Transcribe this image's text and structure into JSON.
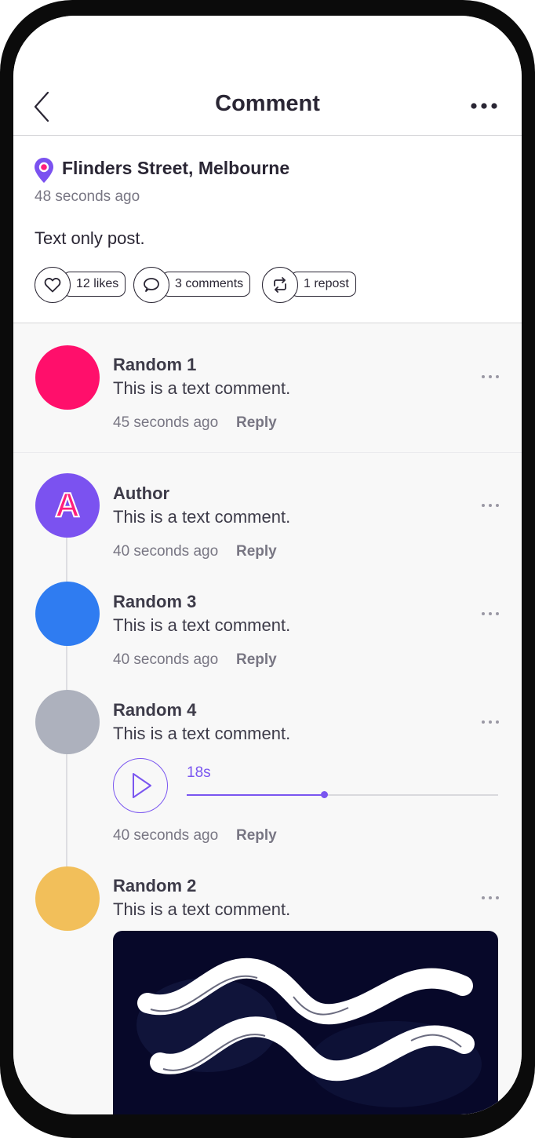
{
  "header": {
    "title": "Comment"
  },
  "post": {
    "location": "Flinders Street, Melbourne",
    "time": "48 seconds ago",
    "text": "Text only post.",
    "likes_label": "12 likes",
    "comments_label": "3 comments",
    "reposts_label": "1 repost"
  },
  "comments": [
    {
      "name": "Random 1",
      "text": "This is a text comment.",
      "time": "45 seconds ago",
      "reply_label": "Reply",
      "avatar_color": "#ff0f6b"
    },
    {
      "name": "Author",
      "text": "This is a text comment.",
      "time": "40 seconds ago",
      "reply_label": "Reply",
      "avatar_color": "#7b52f0",
      "avatar_letter": "A"
    },
    {
      "name": "Random 3",
      "text": "This is a text comment.",
      "time": "40 seconds ago",
      "reply_label": "Reply",
      "avatar_color": "#2f7cf1"
    },
    {
      "name": "Random 4",
      "text": "This is a text comment.",
      "time": "40 seconds ago",
      "reply_label": "Reply",
      "avatar_color": "#adb1bd",
      "audio": {
        "duration": "18s",
        "progress": 0.44
      }
    },
    {
      "name": "Random 2",
      "text": "This is a text comment.",
      "avatar_color": "#f2bf5a",
      "image": "aquarius-symbol-image"
    }
  ],
  "colors": {
    "accent": "#7a56f0",
    "text": "#2a2634",
    "muted": "#787683",
    "image_bg": "#070829"
  }
}
